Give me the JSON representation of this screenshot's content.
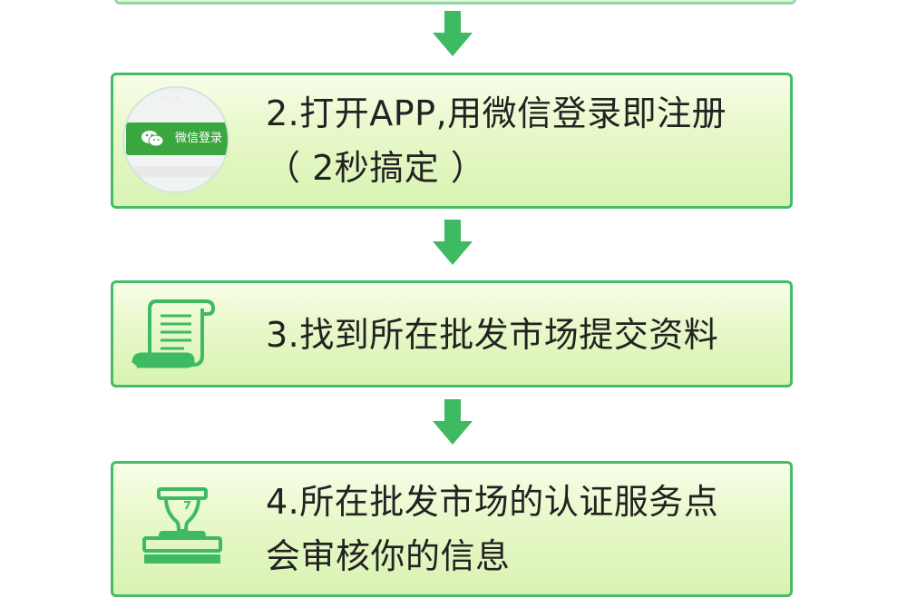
{
  "steps": [
    {
      "id": "step2",
      "lines": [
        "2.打开APP,用微信登录即注册",
        "（ 2秒搞定 ）"
      ],
      "badge_label": "微信登录",
      "icon": "wechat-login-badge-icon"
    },
    {
      "id": "step3",
      "lines": [
        "3.找到所在批发市场提交资料"
      ],
      "icon": "scroll-document-icon"
    },
    {
      "id": "step4",
      "lines": [
        "4.所在批发市场的认证服务点",
        "会审核你的信息"
      ],
      "icon": "stamp-icon"
    }
  ],
  "colors": {
    "accent": "#3dba62",
    "border": "#45bd68",
    "card_top": "#f8fde8",
    "card_bottom": "#d9f3b3",
    "text": "#222222"
  }
}
